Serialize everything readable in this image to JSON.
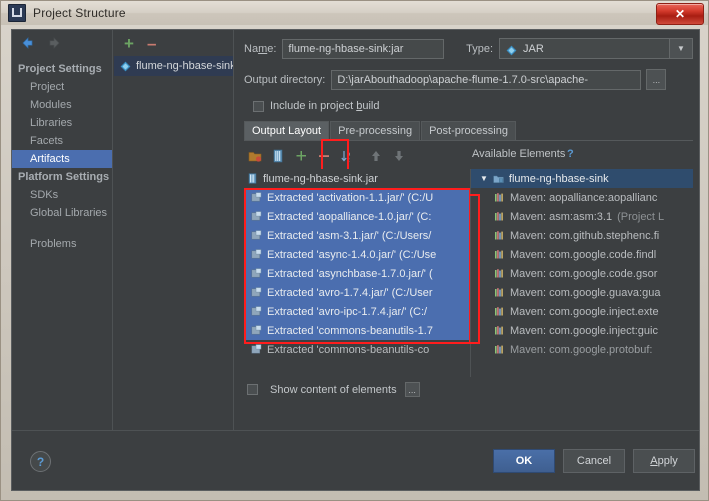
{
  "window": {
    "title": "Project Structure",
    "app_icon": "intellij-idea-icon",
    "close_label": "✕"
  },
  "sidebar": {
    "back_icon": "back-arrow-icon",
    "forward_icon": "forward-arrow-icon",
    "groups": [
      {
        "label": "Project Settings",
        "items": [
          {
            "label": "Project",
            "selected": false
          },
          {
            "label": "Modules",
            "selected": false
          },
          {
            "label": "Libraries",
            "selected": false
          },
          {
            "label": "Facets",
            "selected": false
          },
          {
            "label": "Artifacts",
            "selected": true
          }
        ]
      },
      {
        "label": "Platform Settings",
        "items": [
          {
            "label": "SDKs",
            "selected": false
          },
          {
            "label": "Global Libraries",
            "selected": false
          }
        ]
      }
    ],
    "problems_label": "Problems"
  },
  "artifacts": {
    "toolbar": {
      "add_label": "+",
      "remove_label": "–"
    },
    "items": [
      {
        "label": "flume-ng-hbase-sink:jar",
        "icon": "jar-artifact-icon",
        "selected": true
      }
    ]
  },
  "detail": {
    "name_label": "Name:",
    "name_value": "flume-ng-hbase-sink:jar",
    "type_label": "Type:",
    "type_value": "JAR",
    "type_icon": "jar-artifact-icon",
    "type_dropdown_icon": "chevron-down-icon",
    "output_dir_label": "Output directory:",
    "output_dir_value": "D:\\jarAbouthadoop\\apache-flume-1.7.0-src\\apache-",
    "browse_label": "...",
    "include_in_build_label": "Include in project build",
    "include_in_build_checked": false,
    "tabs": [
      {
        "label": "Output Layout",
        "active": true
      },
      {
        "label": "Pre-processing",
        "active": false
      },
      {
        "label": "Post-processing",
        "active": false
      }
    ]
  },
  "layout_toolbar": {
    "icons": [
      {
        "name": "add-directory-icon"
      },
      {
        "name": "add-archive-icon"
      },
      {
        "name": "add-copy-icon"
      },
      {
        "name": "remove-icon",
        "highlighted": true
      },
      {
        "name": "sort-icon"
      },
      {
        "name": "move-up-icon"
      },
      {
        "name": "move-down-icon"
      }
    ],
    "available_elements_label": "Available Elements",
    "help_label": "?"
  },
  "output_layout": {
    "root": {
      "label": "flume-ng-hbase-sink.jar",
      "icon": "jar-file-icon"
    },
    "entries": [
      {
        "label": "Extracted 'activation-1.1.jar/' (C:/U",
        "selected": true
      },
      {
        "label": "Extracted 'aopalliance-1.0.jar/' (C:",
        "selected": true
      },
      {
        "label": "Extracted 'asm-3.1.jar/' (C:/Users/",
        "selected": true
      },
      {
        "label": "Extracted 'async-1.4.0.jar/' (C:/Use",
        "selected": true
      },
      {
        "label": "Extracted 'asynchbase-1.7.0.jar/' (",
        "selected": true
      },
      {
        "label": "Extracted 'avro-1.7.4.jar/' (C:/User",
        "selected": true
      },
      {
        "label": "Extracted 'avro-ipc-1.7.4.jar/' (C:/",
        "selected": true
      },
      {
        "label": "Extracted 'commons-beanutils-1.7",
        "selected": true
      },
      {
        "label": "Extracted 'commons-beanutils-co",
        "selected": false
      }
    ]
  },
  "available_elements": {
    "root": {
      "label": "flume-ng-hbase-sink",
      "icon": "module-icon",
      "expander": "▼"
    },
    "entries": [
      {
        "label": "Maven: aopalliance:aopallianc",
        "suffix": ""
      },
      {
        "label": "Maven: asm:asm:3.1",
        "suffix": "(Project L"
      },
      {
        "label": "Maven: com.github.stephenc.fi",
        "suffix": ""
      },
      {
        "label": "Maven: com.google.code.findl",
        "suffix": ""
      },
      {
        "label": "Maven: com.google.code.gsor",
        "suffix": ""
      },
      {
        "label": "Maven: com.google.guava:gua",
        "suffix": ""
      },
      {
        "label": "Maven: com.google.inject.exte",
        "suffix": ""
      },
      {
        "label": "Maven: com.google.inject:guic",
        "suffix": ""
      },
      {
        "label": "Maven: com.google.protobuf:",
        "suffix": ""
      }
    ]
  },
  "footer": {
    "show_content_label": "Show content of elements",
    "show_content_checked": false,
    "show_content_more": "...",
    "help_label": "?",
    "buttons": [
      {
        "label": "OK",
        "primary": true
      },
      {
        "label": "Cancel",
        "primary": false
      },
      {
        "label": "Apply",
        "primary": false
      }
    ]
  },
  "colors": {
    "accent_selection": "#4b6eaf",
    "highlight_rect": "#ff1d1d",
    "dark_bg": "#3c3f41",
    "close_red": "#d33a2c",
    "link_blue": "#5b9bd5"
  }
}
